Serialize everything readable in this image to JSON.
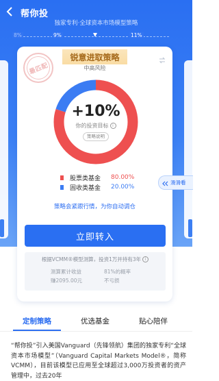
{
  "header": {
    "title": "帮你投",
    "subtitle": "独家专利·全球资本市场模型策略"
  },
  "return_scale": {
    "ticks": [
      "8%",
      "9%",
      "11%"
    ],
    "selected_target": "10%"
  },
  "card": {
    "stamp_text": "最匹配",
    "strategy_name": "锐意进取策略",
    "risk_level": "中高风险",
    "target_value": "+10%",
    "target_label": "你的投资目标",
    "explain_button": "策略说明",
    "allocation": [
      {
        "name": "股票类基金",
        "value": "80.00%",
        "percent": 80,
        "color": "#ee5050"
      },
      {
        "name": "固收类基金",
        "value": "20.00%",
        "percent": 20,
        "color": "#3b7cf3"
      }
    ],
    "note": "策略会紧跟行情，为你自动调仓",
    "primary_button": "立即转入",
    "calc_header": "根据VCMM®模型测算，投资1万并持有3年",
    "calc_left_label": "测算累计收益",
    "calc_left_value": "赚2095.00元",
    "calc_right_label": "81%的概率",
    "calc_right_value": "不亏损"
  },
  "swipe_hint": "滑滑看",
  "tabs": [
    {
      "label": "定制策略",
      "active": true
    },
    {
      "label": "优选基金",
      "active": false
    },
    {
      "label": "贴心陪伴",
      "active": false
    }
  ],
  "description": "“帮你投”引入美国Vanguard（先锋领航）集团的独家专利“全球资本市场模型”（Vanguard Capital Markets Model®，简称VCMM），目前该模型已应用至全球超过3,000万投资者的资产管理中，过去20年",
  "colors": {
    "brand_blue": "#2a6ff2",
    "stock_red": "#ee5050",
    "bond_blue": "#3b7cf3",
    "banner_gold": "#a5691b"
  }
}
